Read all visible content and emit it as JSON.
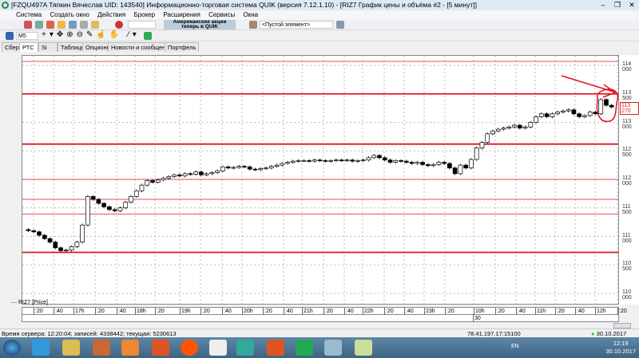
{
  "window": {
    "title": "[FZQU497A Тяпкин Вячеслав UID: 143540] Информационно-торговая система QUIK (версия 7.12.1.10) - [RIZ7 График цены и объёма #2 - [5 минут]]"
  },
  "menu": [
    "Система",
    "Создать окно",
    "Действия",
    "Брокер",
    "Расширения",
    "Сервисы",
    "Окна"
  ],
  "toolbar": {
    "banner": "Американские акции теперь в QUIK",
    "element_select": "<Пустой элемент>",
    "interval_select": "M5"
  },
  "tabs": [
    {
      "label": "Сбер"
    },
    {
      "label": "РТС",
      "active": true
    },
    {
      "label": "Si"
    },
    {
      "label": "Таблицы"
    },
    {
      "label": "Опционы"
    },
    {
      "label": "Новости и сообщения"
    },
    {
      "label": "Портфель"
    }
  ],
  "chart": {
    "series_name": "RIZ7 [Price]",
    "current_price": "113 270",
    "y_ticks": [
      "114 000",
      "113 500",
      "113 000",
      "112 500",
      "112 000",
      "111 500",
      "111 000",
      "110 500",
      "110 000"
    ],
    "ylim": [
      110000,
      114000
    ],
    "levels": [
      114070,
      113500,
      112620,
      112000,
      111650,
      111390,
      110720
    ],
    "annotation_color": "#e0141e",
    "x_labels": [
      ":20",
      ":40",
      "17h",
      ":20",
      ":40",
      "18h",
      ":20",
      "19h",
      ":20",
      ":40",
      "20h",
      ":20",
      ":40",
      "21h",
      ":20",
      ":40",
      "22h",
      ":20",
      ":40",
      "23h",
      ":20",
      "10h",
      ":20",
      ":40",
      "11h",
      ":20",
      ":40",
      "12h",
      ":20"
    ],
    "date_label": "30",
    "closes": [
      111100,
      111080,
      111020,
      110960,
      110900,
      110800,
      110750,
      110760,
      110820,
      110900,
      111200,
      111700,
      111650,
      111580,
      111520,
      111470,
      111450,
      111500,
      111600,
      111700,
      111800,
      111900,
      111980,
      111950,
      111990,
      112020,
      112050,
      112080,
      112060,
      112100,
      112090,
      112130,
      112080,
      112100,
      112120,
      112150,
      112220,
      112200,
      112210,
      112230,
      112220,
      112180,
      112170,
      112190,
      112200,
      112230,
      112250,
      112280,
      112300,
      112320,
      112330,
      112330,
      112320,
      112340,
      112330,
      112320,
      112330,
      112340,
      112330,
      112340,
      112320,
      112330,
      112340,
      112380,
      112420,
      112380,
      112340,
      112300,
      112330,
      112320,
      112300,
      112280,
      112300,
      112260,
      112240,
      112260,
      112300,
      112280,
      112200,
      112100,
      112250,
      112200,
      112350,
      112550,
      112650,
      112800,
      112850,
      112880,
      112900,
      112920,
      112950,
      112900,
      112920,
      113000,
      113100,
      113150,
      113100,
      113150,
      113180,
      113200,
      113220,
      113150,
      113100,
      113120,
      113180,
      113150,
      113400,
      113300,
      113270
    ]
  },
  "status": {
    "text": "Время сервера: 12:20:04; записей: 4338442; текущая: 5230613",
    "connection": "78.41.197.17:15100",
    "date": "30.10.2017"
  },
  "tray": {
    "lang": "EN",
    "time": "12:19",
    "date": "30.10.2017"
  }
}
